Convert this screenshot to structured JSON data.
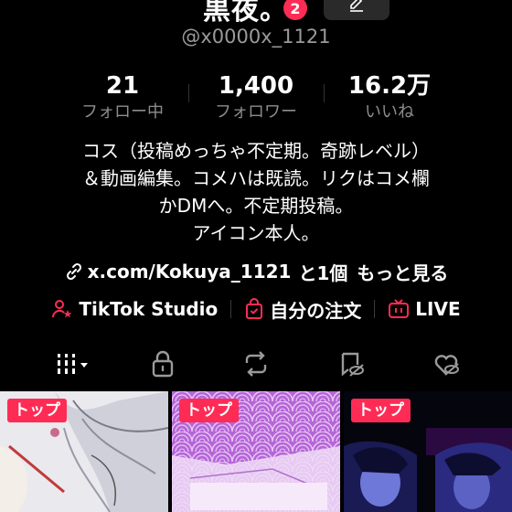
{
  "profile": {
    "display_name": "黒夜。",
    "notification_count": "2",
    "username": "@x0000x_1121"
  },
  "stats": [
    {
      "value": "21",
      "label": "フォロー中"
    },
    {
      "value": "1,400",
      "label": "フォロワー"
    },
    {
      "value": "16.2万",
      "label": "いいね"
    }
  ],
  "bio": [
    "コス（投稿めっちゃ不定期。奇跡レベル）",
    "＆動画編集。コメハは既読。リクはコメ欄",
    "かDMへ。不定期投稿。",
    "アイコン本人。"
  ],
  "link": {
    "url": "x.com/Kokuya_1121",
    "extra": "と1個",
    "more": "もっと見る"
  },
  "actions": [
    {
      "label": "TikTok Studio",
      "icon": "user-star-icon"
    },
    {
      "label": "自分の注文",
      "icon": "shopping-bag-icon"
    },
    {
      "label": "LIVE",
      "icon": "tv-icon"
    }
  ],
  "tabs": [
    "videos-grid-icon",
    "lock-icon",
    "repost-icon",
    "bookmark-eye-off-icon",
    "heart-eye-off-icon"
  ],
  "videos": [
    {
      "badge": "トップ"
    },
    {
      "badge": "トップ"
    },
    {
      "badge": "トップ"
    }
  ],
  "colors": {
    "accent": "#fe2c55",
    "muted": "#8d8d8d"
  }
}
